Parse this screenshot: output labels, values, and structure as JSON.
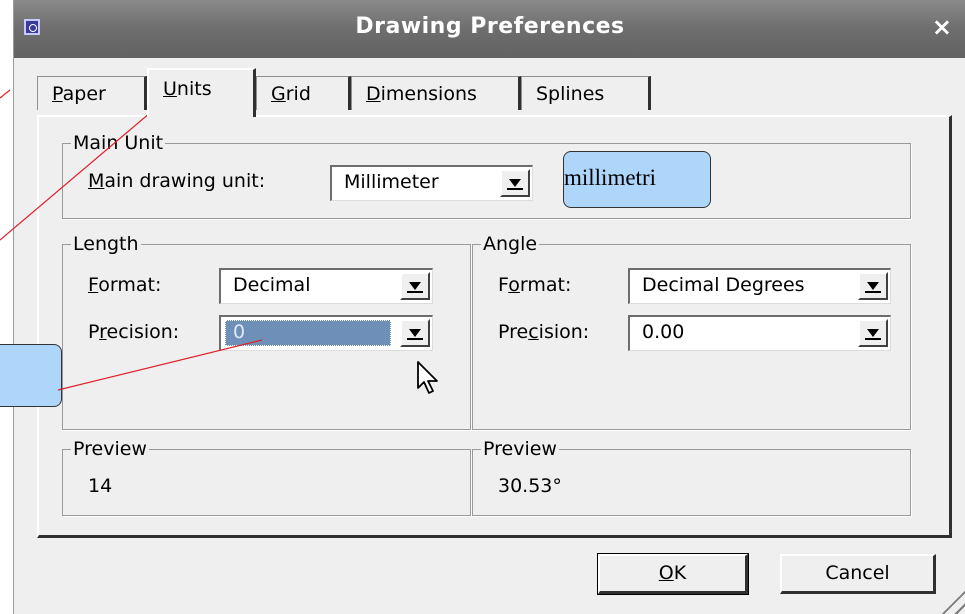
{
  "window": {
    "title": "Drawing Preferences",
    "close_symbol": "×"
  },
  "tabs": [
    {
      "label": "Paper",
      "mnemonic": "P",
      "rest": "aper"
    },
    {
      "label": "Units",
      "mnemonic": "U",
      "rest": "nits",
      "active": true
    },
    {
      "label": "Grid",
      "mnemonic": "G",
      "rest": "rid"
    },
    {
      "label": "Dimensions",
      "mnemonic": "D",
      "rest": "imensions"
    },
    {
      "label": "Splines",
      "mnemonic": "",
      "rest": "Splines"
    }
  ],
  "main_unit": {
    "legend": "Main Unit",
    "label_mnemonic": "M",
    "label_rest": "ain drawing unit:",
    "value": "Millimeter"
  },
  "length": {
    "legend": "Length",
    "format_mnemonic": "F",
    "format_rest": "ormat:",
    "format_value": "Decimal",
    "precision_pre": "P",
    "precision_mnemonic": "r",
    "precision_rest": "ecision:",
    "precision_value": "0"
  },
  "angle": {
    "legend": "Angle",
    "format_pre": "F",
    "format_mnemonic": "o",
    "format_rest": "rmat:",
    "format_value": "Decimal Degrees",
    "precision_pre": "Pre",
    "precision_mnemonic": "c",
    "precision_rest": "ision:",
    "precision_value": "0.00"
  },
  "preview_length": {
    "legend": "Preview",
    "value": "14"
  },
  "preview_angle": {
    "legend": "Preview",
    "value": "30.53°"
  },
  "buttons": {
    "ok_mnemonic": "O",
    "ok_rest": "K",
    "cancel": "Cancel"
  },
  "annotations": {
    "callout_text": "millimetri",
    "callout_color": "#aed6fa",
    "leader_color": "#e0202a"
  }
}
